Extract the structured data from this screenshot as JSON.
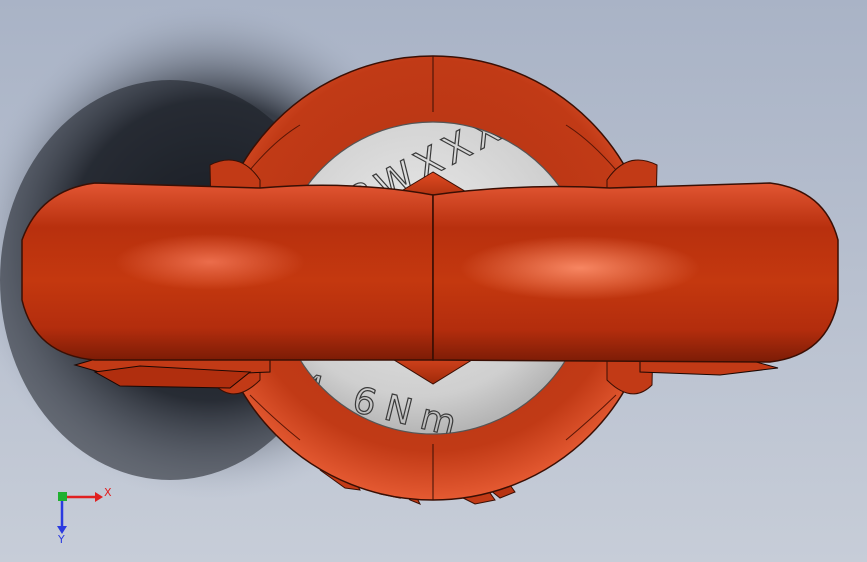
{
  "model": {
    "engraving_top": "8WXXX",
    "engraving_bottom": "4 6Nm"
  },
  "triad": {
    "x_label": "X",
    "y_label": "Y"
  },
  "colors": {
    "background_light": "#a8b4c8",
    "background_dark": "#1a1e24",
    "body_orange": "#c83a14",
    "body_highlight": "#f06a4a",
    "body_shadow": "#7a1e08",
    "disc": "#d2d2d2",
    "x_axis": "#e02020",
    "y_axis": "#2a3ae0",
    "origin": "#20b030"
  }
}
